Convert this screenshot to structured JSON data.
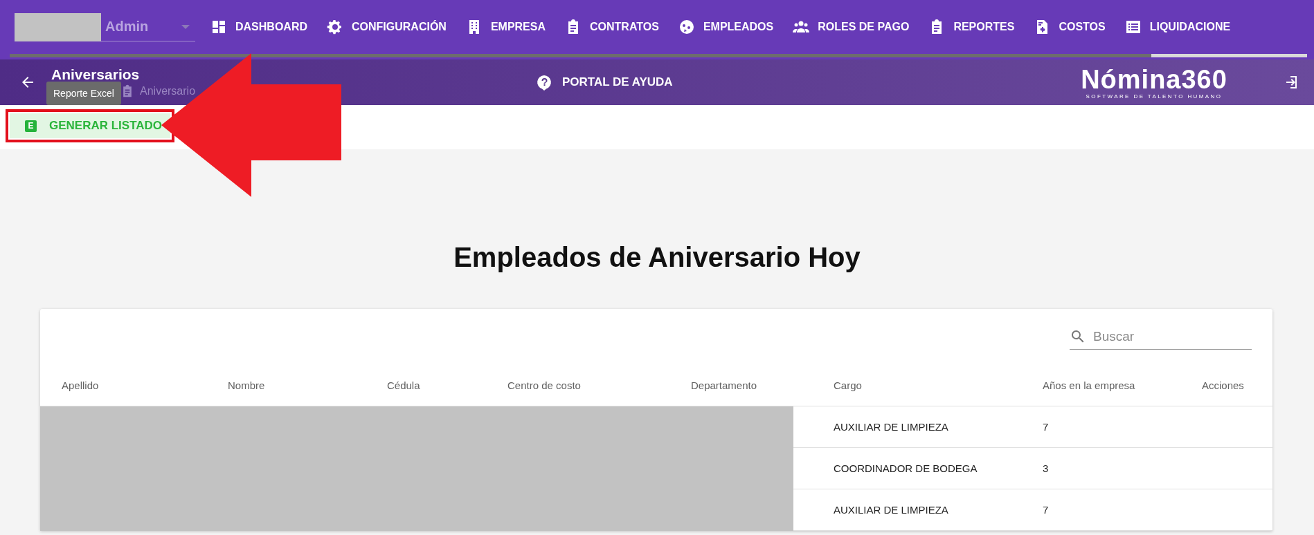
{
  "nav": {
    "user": "Admin",
    "items": [
      {
        "label": "DASHBOARD"
      },
      {
        "label": "CONFIGURACIÓN"
      },
      {
        "label": "EMPRESA"
      },
      {
        "label": "CONTRATOS"
      },
      {
        "label": "EMPLEADOS"
      },
      {
        "label": "ROLES DE PAGO"
      },
      {
        "label": "REPORTES"
      },
      {
        "label": "COSTOS"
      },
      {
        "label": "LIQUIDACIONE"
      }
    ],
    "progress": {
      "level": 0.88
    }
  },
  "header": {
    "title": "Aniversarios",
    "breadcrumb": "Aniversario",
    "help": "PORTAL DE AYUDA",
    "logo": "Nómina360",
    "logo_tagline": "SOFTWARE DE TALENTO HUMANO"
  },
  "toolbar": {
    "tooltip": "Reporte Excel",
    "badge": "E",
    "button": "GENERAR LISTADO"
  },
  "page_title": "Empleados de Aniversario Hoy",
  "table": {
    "search": {
      "placeholder": "Buscar"
    },
    "columns": [
      "Apellido",
      "Nombre",
      "Cédula",
      "Centro de costo",
      "Departamento",
      "Cargo",
      "Años en la empresa",
      "Acciones"
    ],
    "rows": [
      {
        "cargo": "AUXILIAR DE LIMPIEZA",
        "years": "7"
      },
      {
        "cargo": "COORDINADOR DE BODEGA",
        "years": "3"
      },
      {
        "cargo": "AUXILIAR DE LIMPIEZA",
        "years": "7"
      }
    ]
  }
}
